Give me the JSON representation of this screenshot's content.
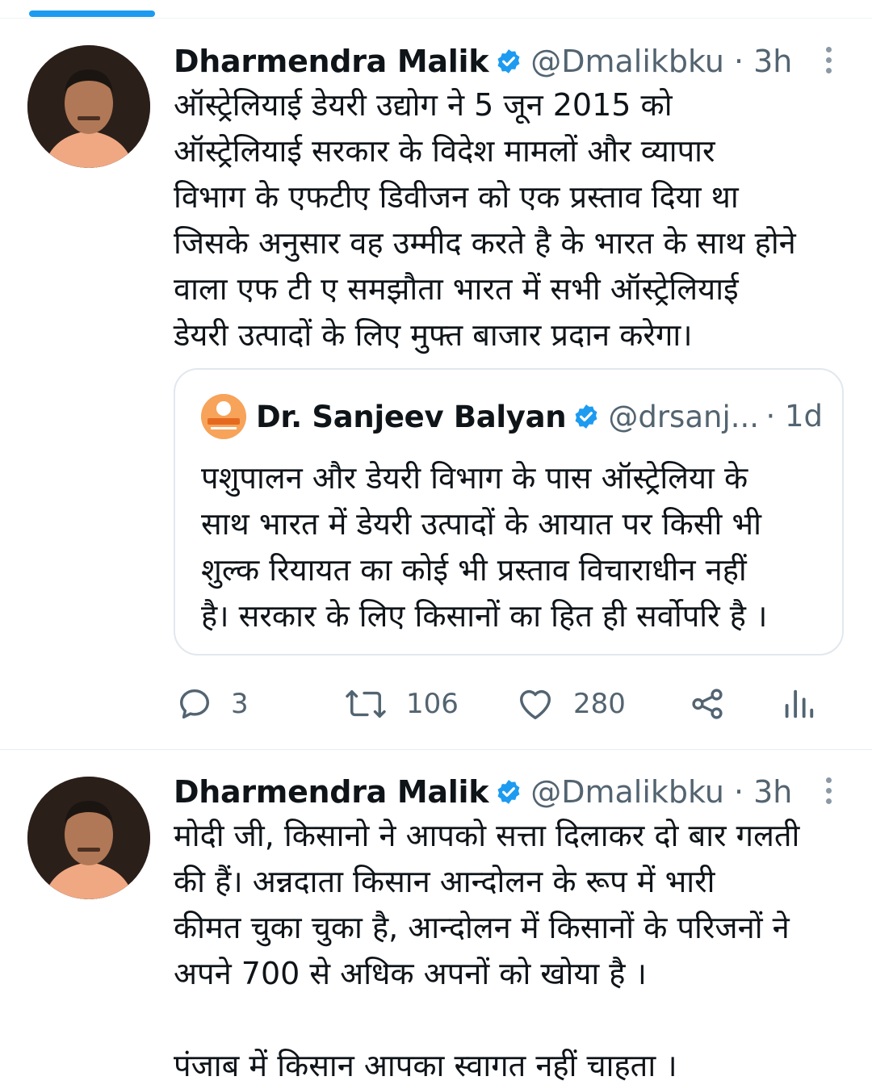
{
  "tweets": [
    {
      "author": {
        "name": "Dharmendra Malik",
        "handle": "@Dmalikbku",
        "time": "· 3h"
      },
      "text": "ऑस्ट्रेलियाई डेयरी उद्योग ने 5 जून 2015 को\nऑस्ट्रेलियाई सरकार के विदेश मामलों और व्यापार\nविभाग के एफटीए डिवीजन को एक प्रस्ताव दिया था\nजिसके अनुसार वह उम्मीद करते है के भारत के साथ होने\nवाला एफ टी ए समझौता भारत में सभी ऑस्ट्रेलियाई\nडेयरी उत्पादों के लिए मुफ्त बाजार प्रदान करेगा।",
      "quoted": {
        "author": {
          "name": "Dr. Sanjeev Balyan",
          "handle": "@drsanj...",
          "time": "· 1d"
        },
        "text": "पशुपालन और डेयरी विभाग के पास ऑस्ट्रेलिया के\nसाथ भारत में डेयरी उत्पादों के आयात पर किसी भी\nशुल्क रियायत का कोई भी प्रस्ताव विचाराधीन नहीं\nहै। सरकार के लिए किसानों का हित ही सर्वोपरि है ।"
      },
      "actions": {
        "replies": "3",
        "retweets": "106",
        "likes": "280"
      }
    },
    {
      "author": {
        "name": "Dharmendra Malik",
        "handle": "@Dmalikbku",
        "time": "· 3h"
      },
      "text": "मोदी जी, किसानो ने आपको सत्ता दिलाकर दो बार गलती\nकी हैं।  अन्नदाता किसान आन्दोलन के रूप में भारी\nकीमत चुका चुका है, आन्दोलन में किसानों के परिजनों ने\nअपने 700 से अधिक अपनों को खोया है ।\n\n   पंजाब में किसान आपका स्वागत नहीं चाहता ।"
    }
  ],
  "icons": {
    "verified": "verified-badge-icon",
    "more": "more-vertical-icon",
    "reply": "reply-icon",
    "retweet": "retweet-icon",
    "like": "heart-icon",
    "share": "share-icon",
    "analytics": "analytics-icon"
  },
  "colors": {
    "accent": "#1d9bf0",
    "secondary_text": "#536471",
    "quote_avatar": "#f7a35a"
  }
}
